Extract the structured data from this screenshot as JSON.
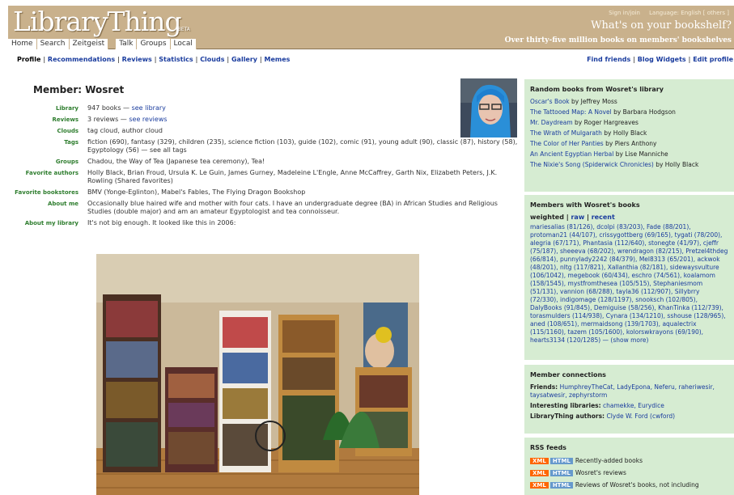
{
  "header": {
    "logo": "LibraryThing",
    "beta": "BETA",
    "tabs": [
      "Home",
      "Search",
      "Zeitgeist",
      "Talk",
      "Groups",
      "Local"
    ],
    "signin": "Sign in/join",
    "language": "Language: English",
    "others": "[ others ]",
    "slogan": "What's on your bookshelf?",
    "subslogan": "Over thirty-five million books on members' bookshelves"
  },
  "subnav": {
    "items": [
      "Profile",
      "Recommendations",
      "Reviews",
      "Statistics",
      "Clouds",
      "Gallery",
      "Memes"
    ],
    "right": [
      "Find friends",
      "Blog Widgets",
      "Edit profile"
    ]
  },
  "member": {
    "title": "Member: Wosret"
  },
  "profile": {
    "library_label": "Library",
    "library_value": "947 books",
    "library_link": "see library",
    "reviews_label": "Reviews",
    "reviews_value": "3 reviews",
    "reviews_link": "see reviews",
    "clouds_label": "Clouds",
    "clouds_value": "tag cloud, author cloud",
    "tags_label": "Tags",
    "tags_value": "fiction (690), fantasy (329), children (235), science fiction (103), guide (102), comic (91), young adult (90), classic (87), history (58), Egyptology (56) — see all tags",
    "groups_label": "Groups",
    "groups_value": "Chadou, the Way of Tea (Japanese tea ceremony), Tea!",
    "authors_label": "Favorite authors",
    "authors_value": "Holly Black, Brian Froud, Ursula K. Le Guin, James Gurney, Madeleine L'Engle, Anne McCaffrey, Garth Nix, Elizabeth Peters, J.K. Rowling (Shared favorites)",
    "bookstores_label": "Favorite bookstores",
    "bookstores_value": "BMV (Yonge-Eglinton), Mabel's Fables, The Flying Dragon Bookshop",
    "about_label": "About me",
    "about_value": "Occasionally blue haired wife and mother with four cats. I have an undergraduate degree (BA) in African Studies and Religious Studies (double major) and am an amateur Egyptologist and tea connoisseur.",
    "aboutlib_label": "About my library",
    "aboutlib_value": "It's not big enough. It looked like this in 2006:"
  },
  "random_books": {
    "title": "Random books from Wosret's library",
    "items": [
      {
        "t": "Oscar's Book",
        "a": "by Jeffrey Moss"
      },
      {
        "t": "The Tattooed Map: A Novel",
        "a": "by Barbara Hodgson"
      },
      {
        "t": "Mr. Daydream",
        "a": "by Roger Hargreaves"
      },
      {
        "t": "The Wrath of Mulgarath",
        "a": "by Holly Black"
      },
      {
        "t": "The Color of Her Panties",
        "a": "by Piers Anthony"
      },
      {
        "t": "An Ancient Egyptian Herbal",
        "a": "by Lise Manniche"
      },
      {
        "t": "The Nixie's Song (Spiderwick Chronicles)",
        "a": "by Holly Black"
      }
    ]
  },
  "members": {
    "title": "Members with Wosret's books",
    "weighted": "weighted",
    "raw": "raw",
    "recent": "recent",
    "list": "mariesalias (81/126), dcolpi (83/203), Fade (88/201), protoman21 (44/107), crissygottberg (69/165), tygati (78/200), alegria (67/171), Phantasia (112/640), stonegte (41/97), cjeffr (75/187), sheeeva (68/202), wrendragon (82/215), Pretzel4thdeg (66/814), punnylady2242 (84/379), Mel8313 (65/201), ackwok (48/201), nltg (117/821), Xallanthia (82/181), sidewaysvulture (106/1042), megebook (60/434), eschro (74/561), koalamom (158/1545), mystfromthesea (105/515), Stephaniesmom (51/131), vannion (68/288), tayla36 (112/907), Sillybrry (72/330), indigomage (128/1197), snooksch (102/805), DalyBooks (91/845), Demiguise (58/256), KhanTinka (112/739), torasmulders (114/938), Cynara (134/1210), sshouse (128/965), aned (108/651), mermaidsong (139/1703), aqualectrix (115/1160), tazem (105/1600), kolorswkrayons (69/190), hearts3134 (120/1285) — (show more)"
  },
  "connections": {
    "title": "Member connections",
    "friends_label": "Friends:",
    "friends": "HumphreyTheCat, LadyEpona, Neferu, raheriwesir, taysatwesir, zephyrstorm",
    "libraries_label": "Interesting libraries:",
    "libraries": "chamekke, Eurydice",
    "authors_label": "LibraryThing authors:",
    "authors": "Clyde W. Ford (cwford)"
  },
  "rss": {
    "title": "RSS feeds",
    "xml": "XML",
    "html": "HTML",
    "feeds": [
      "Recently-added books",
      "Wosret's reviews",
      "Reviews of Wosret's books, not including"
    ]
  }
}
